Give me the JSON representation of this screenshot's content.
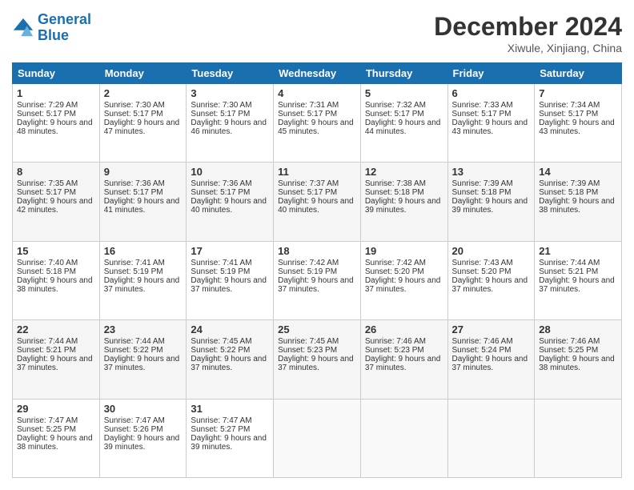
{
  "header": {
    "logo_line1": "General",
    "logo_line2": "Blue",
    "main_title": "December 2024",
    "subtitle": "Xiwule, Xinjiang, China"
  },
  "calendar": {
    "days_of_week": [
      "Sunday",
      "Monday",
      "Tuesday",
      "Wednesday",
      "Thursday",
      "Friday",
      "Saturday"
    ],
    "weeks": [
      [
        {
          "day": "1",
          "sunrise": "Sunrise: 7:29 AM",
          "sunset": "Sunset: 5:17 PM",
          "daylight": "Daylight: 9 hours and 48 minutes."
        },
        {
          "day": "2",
          "sunrise": "Sunrise: 7:30 AM",
          "sunset": "Sunset: 5:17 PM",
          "daylight": "Daylight: 9 hours and 47 minutes."
        },
        {
          "day": "3",
          "sunrise": "Sunrise: 7:30 AM",
          "sunset": "Sunset: 5:17 PM",
          "daylight": "Daylight: 9 hours and 46 minutes."
        },
        {
          "day": "4",
          "sunrise": "Sunrise: 7:31 AM",
          "sunset": "Sunset: 5:17 PM",
          "daylight": "Daylight: 9 hours and 45 minutes."
        },
        {
          "day": "5",
          "sunrise": "Sunrise: 7:32 AM",
          "sunset": "Sunset: 5:17 PM",
          "daylight": "Daylight: 9 hours and 44 minutes."
        },
        {
          "day": "6",
          "sunrise": "Sunrise: 7:33 AM",
          "sunset": "Sunset: 5:17 PM",
          "daylight": "Daylight: 9 hours and 43 minutes."
        },
        {
          "day": "7",
          "sunrise": "Sunrise: 7:34 AM",
          "sunset": "Sunset: 5:17 PM",
          "daylight": "Daylight: 9 hours and 43 minutes."
        }
      ],
      [
        {
          "day": "8",
          "sunrise": "Sunrise: 7:35 AM",
          "sunset": "Sunset: 5:17 PM",
          "daylight": "Daylight: 9 hours and 42 minutes."
        },
        {
          "day": "9",
          "sunrise": "Sunrise: 7:36 AM",
          "sunset": "Sunset: 5:17 PM",
          "daylight": "Daylight: 9 hours and 41 minutes."
        },
        {
          "day": "10",
          "sunrise": "Sunrise: 7:36 AM",
          "sunset": "Sunset: 5:17 PM",
          "daylight": "Daylight: 9 hours and 40 minutes."
        },
        {
          "day": "11",
          "sunrise": "Sunrise: 7:37 AM",
          "sunset": "Sunset: 5:17 PM",
          "daylight": "Daylight: 9 hours and 40 minutes."
        },
        {
          "day": "12",
          "sunrise": "Sunrise: 7:38 AM",
          "sunset": "Sunset: 5:18 PM",
          "daylight": "Daylight: 9 hours and 39 minutes."
        },
        {
          "day": "13",
          "sunrise": "Sunrise: 7:39 AM",
          "sunset": "Sunset: 5:18 PM",
          "daylight": "Daylight: 9 hours and 39 minutes."
        },
        {
          "day": "14",
          "sunrise": "Sunrise: 7:39 AM",
          "sunset": "Sunset: 5:18 PM",
          "daylight": "Daylight: 9 hours and 38 minutes."
        }
      ],
      [
        {
          "day": "15",
          "sunrise": "Sunrise: 7:40 AM",
          "sunset": "Sunset: 5:18 PM",
          "daylight": "Daylight: 9 hours and 38 minutes."
        },
        {
          "day": "16",
          "sunrise": "Sunrise: 7:41 AM",
          "sunset": "Sunset: 5:19 PM",
          "daylight": "Daylight: 9 hours and 37 minutes."
        },
        {
          "day": "17",
          "sunrise": "Sunrise: 7:41 AM",
          "sunset": "Sunset: 5:19 PM",
          "daylight": "Daylight: 9 hours and 37 minutes."
        },
        {
          "day": "18",
          "sunrise": "Sunrise: 7:42 AM",
          "sunset": "Sunset: 5:19 PM",
          "daylight": "Daylight: 9 hours and 37 minutes."
        },
        {
          "day": "19",
          "sunrise": "Sunrise: 7:42 AM",
          "sunset": "Sunset: 5:20 PM",
          "daylight": "Daylight: 9 hours and 37 minutes."
        },
        {
          "day": "20",
          "sunrise": "Sunrise: 7:43 AM",
          "sunset": "Sunset: 5:20 PM",
          "daylight": "Daylight: 9 hours and 37 minutes."
        },
        {
          "day": "21",
          "sunrise": "Sunrise: 7:44 AM",
          "sunset": "Sunset: 5:21 PM",
          "daylight": "Daylight: 9 hours and 37 minutes."
        }
      ],
      [
        {
          "day": "22",
          "sunrise": "Sunrise: 7:44 AM",
          "sunset": "Sunset: 5:21 PM",
          "daylight": "Daylight: 9 hours and 37 minutes."
        },
        {
          "day": "23",
          "sunrise": "Sunrise: 7:44 AM",
          "sunset": "Sunset: 5:22 PM",
          "daylight": "Daylight: 9 hours and 37 minutes."
        },
        {
          "day": "24",
          "sunrise": "Sunrise: 7:45 AM",
          "sunset": "Sunset: 5:22 PM",
          "daylight": "Daylight: 9 hours and 37 minutes."
        },
        {
          "day": "25",
          "sunrise": "Sunrise: 7:45 AM",
          "sunset": "Sunset: 5:23 PM",
          "daylight": "Daylight: 9 hours and 37 minutes."
        },
        {
          "day": "26",
          "sunrise": "Sunrise: 7:46 AM",
          "sunset": "Sunset: 5:23 PM",
          "daylight": "Daylight: 9 hours and 37 minutes."
        },
        {
          "day": "27",
          "sunrise": "Sunrise: 7:46 AM",
          "sunset": "Sunset: 5:24 PM",
          "daylight": "Daylight: 9 hours and 37 minutes."
        },
        {
          "day": "28",
          "sunrise": "Sunrise: 7:46 AM",
          "sunset": "Sunset: 5:25 PM",
          "daylight": "Daylight: 9 hours and 38 minutes."
        }
      ],
      [
        {
          "day": "29",
          "sunrise": "Sunrise: 7:47 AM",
          "sunset": "Sunset: 5:25 PM",
          "daylight": "Daylight: 9 hours and 38 minutes."
        },
        {
          "day": "30",
          "sunrise": "Sunrise: 7:47 AM",
          "sunset": "Sunset: 5:26 PM",
          "daylight": "Daylight: 9 hours and 39 minutes."
        },
        {
          "day": "31",
          "sunrise": "Sunrise: 7:47 AM",
          "sunset": "Sunset: 5:27 PM",
          "daylight": "Daylight: 9 hours and 39 minutes."
        },
        null,
        null,
        null,
        null
      ]
    ]
  }
}
